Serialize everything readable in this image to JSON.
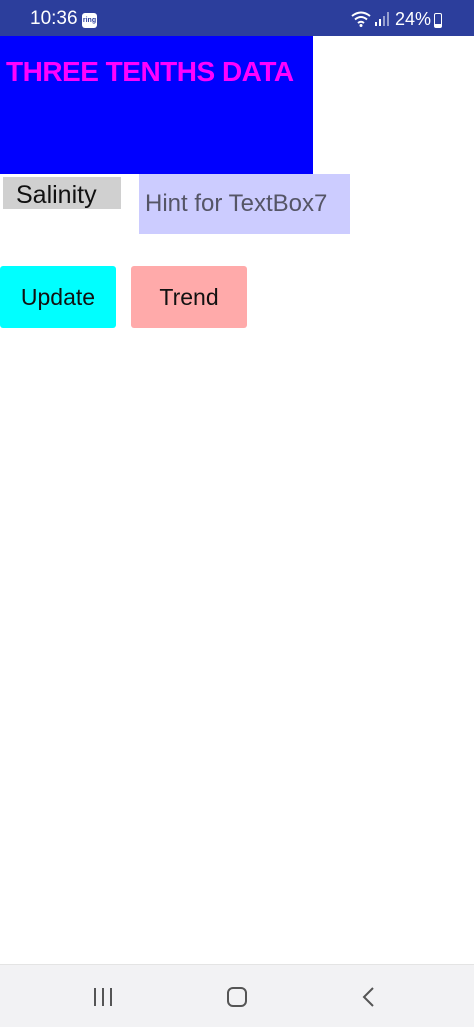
{
  "status_bar": {
    "time": "10:36",
    "notification_icon_text": "ring",
    "battery": "24%"
  },
  "title": {
    "text": "THREE TENTHS DATA",
    "color": "#ff00ff",
    "background": "#0000ff"
  },
  "form": {
    "salinity_label": "Salinity",
    "textbox_placeholder": "Hint for TextBox7",
    "textbox_value": ""
  },
  "buttons": {
    "update_label": "Update",
    "update_color": "#00ffff",
    "trend_label": "Trend",
    "trend_color": "#ffaaaa"
  },
  "nav_bar": {
    "icons": [
      "recent-apps-icon",
      "home-icon",
      "back-icon"
    ]
  }
}
